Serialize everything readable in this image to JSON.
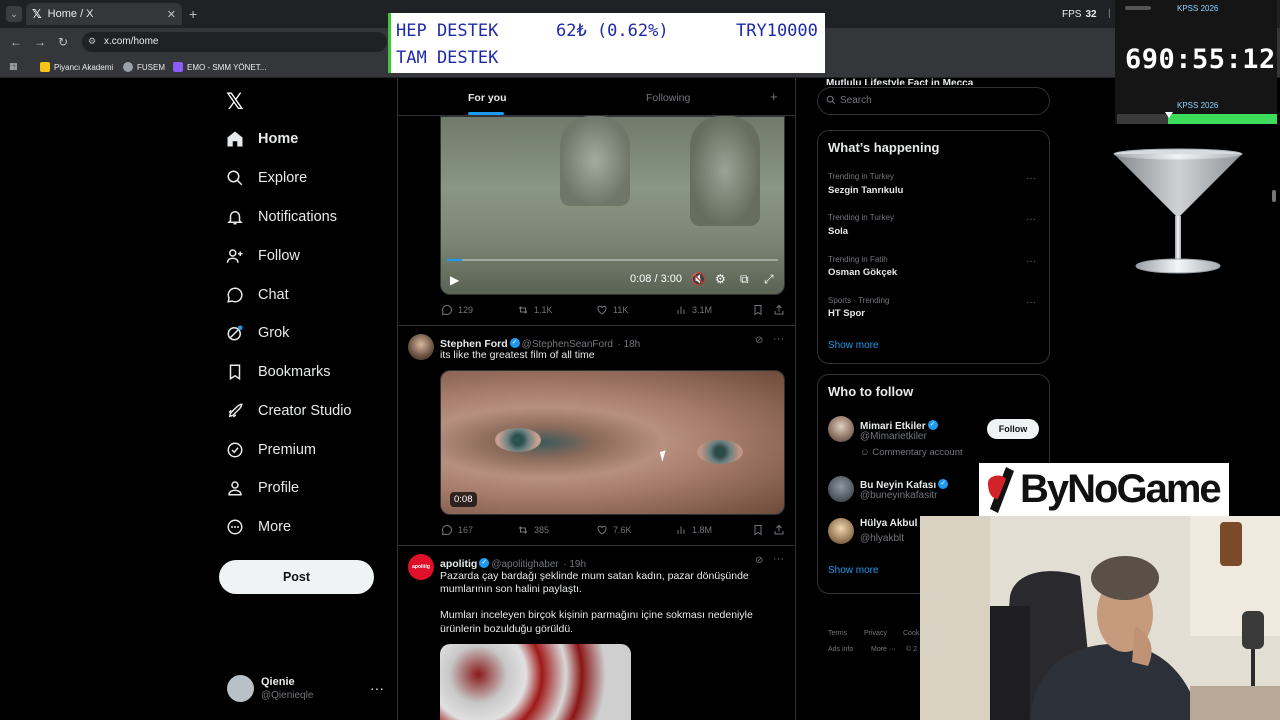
{
  "browser": {
    "tab_title": "Home / X",
    "tab_close": "✕",
    "new_tab": "+",
    "url": "x.com/home",
    "fps_label": "FPS",
    "fps_value": "32",
    "fps_sep": "|",
    "bookmarks": [
      {
        "label": "Piyancı Akademi",
        "color": "#f5c518"
      },
      {
        "label": "FUSEM",
        "color": "#9aa0a6"
      },
      {
        "label": "EMO - SMM YÖNET...",
        "color": "#8a5cf6"
      }
    ]
  },
  "donation": {
    "line1_left": "HEP DESTEK",
    "line1_mid": "62₺ (0.62%)",
    "line1_right": "TRY10000",
    "line2": "TAM DESTEK"
  },
  "timer": {
    "header": "KPSS 2026",
    "value": "690:55:12",
    "footer": "KPSS 2026",
    "progress": 0.68
  },
  "nav": {
    "logo": "𝕏",
    "items": [
      {
        "label": "Home",
        "icon": "home-icon",
        "active": true
      },
      {
        "label": "Explore",
        "icon": "search-icon"
      },
      {
        "label": "Notifications",
        "icon": "bell-icon"
      },
      {
        "label": "Follow",
        "icon": "person-add-icon"
      },
      {
        "label": "Chat",
        "icon": "chat-icon"
      },
      {
        "label": "Grok",
        "icon": "grok-icon"
      },
      {
        "label": "Bookmarks",
        "icon": "bookmark-icon"
      },
      {
        "label": "Creator Studio",
        "icon": "rocket-icon"
      },
      {
        "label": "Premium",
        "icon": "verified-icon"
      },
      {
        "label": "Profile",
        "icon": "person-icon"
      },
      {
        "label": "More",
        "icon": "more-circle-icon"
      }
    ],
    "post_label": "Post",
    "profile_name": "Qienie",
    "profile_handle": "@Qienieqle",
    "profile_more": "···"
  },
  "feed": {
    "tabs": [
      {
        "label": "For you",
        "active": true
      },
      {
        "label": "Following"
      }
    ],
    "add_tab": "+",
    "post1": {
      "video_time": "0:08 / 3:00",
      "video_progress": 0.044,
      "replies": "129",
      "reposts": "1.1K",
      "likes": "11K",
      "views": "3.1M"
    },
    "post2": {
      "name": "Stephen Ford",
      "handle": "@StephenSeanFord",
      "time": "· 18h",
      "text": "its like the greatest film of all time",
      "video_time": "0:08",
      "replies": "167",
      "reposts": "385",
      "likes": "7.6K",
      "views": "1.8M"
    },
    "post3": {
      "name": "apolitig",
      "handle": "@apolitighaber",
      "time": "· 19h",
      "avatar_text": "apolitig",
      "text1": "Pazarda çay bardağı şeklinde mum satan kadın, pazar dönüşünde",
      "text2": "mumlarının son halini paylaştı.",
      "text3": "Mumları inceleyen birçok kişinin parmağını içine sokması nedeniyle",
      "text4": "ürünlerin bozulduğu görüldü."
    }
  },
  "sidebar": {
    "cut_text": "Mutlulu Lifestyle Fact in Mecca",
    "search_placeholder": "Search",
    "whats_happening_title": "What’s happening",
    "trends": [
      {
        "category": "Trending in Turkey",
        "name": "Sezgin Tanrıkulu"
      },
      {
        "category": "Trending in Turkey",
        "name": "Sola"
      },
      {
        "category": "Trending in Fatih",
        "name": "Osman Gökçek"
      },
      {
        "category": "Sports · Trending",
        "name": "HT Spor"
      }
    ],
    "trend_more": "···",
    "show_more": "Show more",
    "who_to_follow_title": "Who to follow",
    "follow_suggestions": [
      {
        "name": "Mimari Etkiler",
        "handle": "@Mimarietkiler"
      },
      {
        "name": "Bu Neyin Kafası",
        "handle": "@buneyinkafasitr"
      },
      {
        "name": "Hülya Akbul",
        "handle": "@hlyakblt"
      }
    ],
    "follow_button": "Follow",
    "commentary": "Commentary account",
    "footer_links": [
      "Terms",
      "Privacy",
      "Cook",
      "Ads info",
      "More ···",
      "© 2"
    ]
  },
  "overlays": {
    "bynogame": "ByNoGame"
  }
}
